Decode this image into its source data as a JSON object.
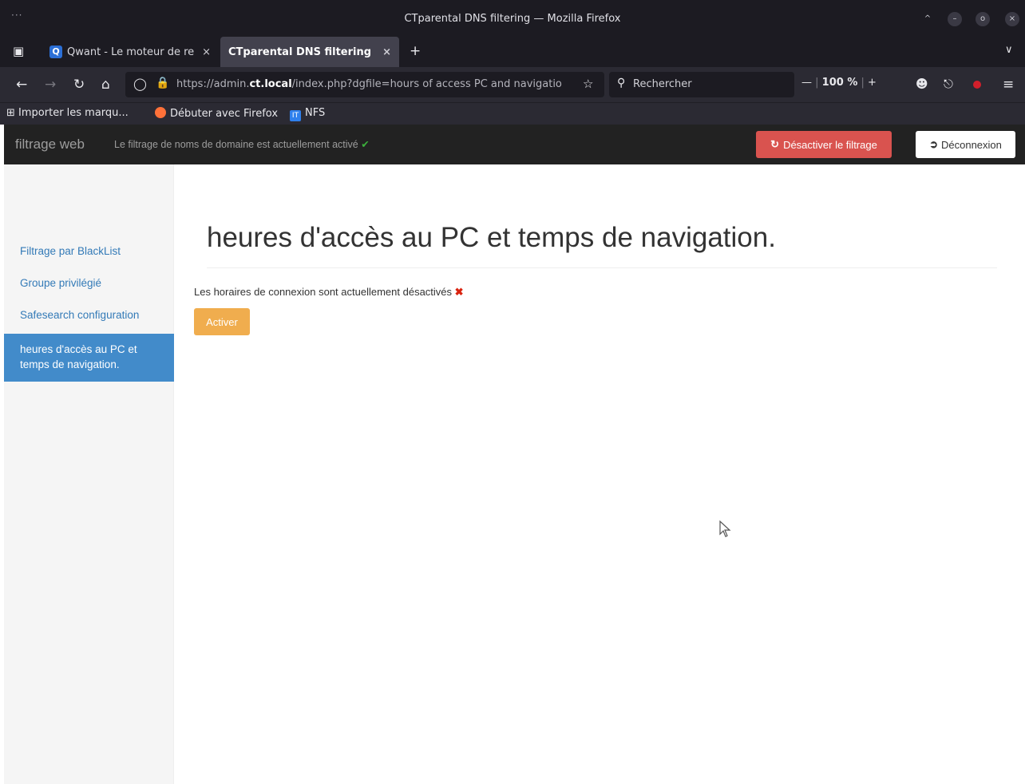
{
  "window": {
    "title": "CTparental DNS filtering — Mozilla Firefox",
    "menu_dots": "···"
  },
  "tabs": [
    {
      "label": "Qwant - Le moteur de re",
      "close": "×",
      "icon": "qwant-icon"
    },
    {
      "label": "CTparental DNS filtering",
      "close": "×",
      "active": true
    }
  ],
  "new_tab": "+",
  "navbar": {
    "url_prefix": "https://admin.",
    "url_domain": "ct.local",
    "url_suffix": "/index.php?dgfile=hours of access PC and navigatio",
    "search_placeholder": "Rechercher",
    "zoom_minus": "—",
    "zoom_level": "100 %",
    "zoom_plus": "+"
  },
  "bookmarks": [
    {
      "label": "Importer les marqu...",
      "icon": "import-icon"
    },
    {
      "label": "Débuter avec Firefox",
      "icon": "firefox-icon"
    },
    {
      "label": "NFS",
      "icon": "it-icon"
    }
  ],
  "app": {
    "brand": "filtrage web",
    "status_text": "Le filtrage de noms de domaine est actuellement activé",
    "status_check": "✔",
    "disable_label": "Désactiver le filtrage",
    "logout_label": "Déconnexion"
  },
  "sidebar": {
    "items": [
      {
        "label": "Filtrage par BlackList"
      },
      {
        "label": "Groupe privilégié"
      },
      {
        "label": "Safesearch configuration"
      },
      {
        "label": "heures d'accès au PC et temps de navigation.",
        "active": true
      }
    ]
  },
  "main": {
    "title": "heures d'accès au PC et temps de navigation.",
    "status_text": "Les horaires de connexion sont actuellement désactivés",
    "status_cross": "✖",
    "activate_label": "Activer"
  },
  "colors": {
    "danger": "#d9534f",
    "warning": "#f0ad4e",
    "primary": "#428bca",
    "link": "#337ab7"
  }
}
